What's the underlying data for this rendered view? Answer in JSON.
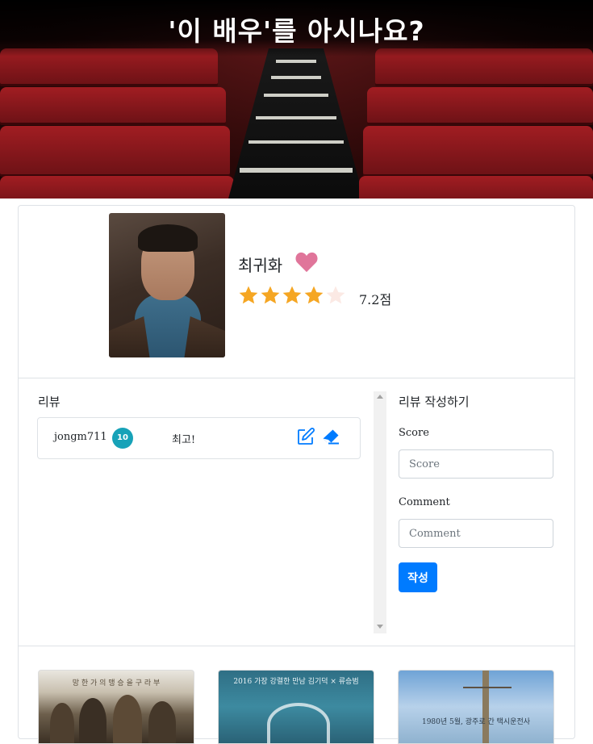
{
  "banner": {
    "title": "'이 배우'를 아시나요?"
  },
  "actor": {
    "name": "최귀화",
    "rating": 7.2,
    "rating_label": "7.2점",
    "stars_filled": 4,
    "stars_total": 5,
    "liked": true
  },
  "reviews": {
    "title": "리뷰",
    "items": [
      {
        "user": "jongm711",
        "score": "10",
        "comment": "최고!"
      }
    ]
  },
  "review_form": {
    "title": "리뷰 작성하기",
    "score_label": "Score",
    "score_placeholder": "Score",
    "comment_label": "Comment",
    "comment_placeholder": "Comment",
    "submit_label": "작성"
  },
  "posters": [
    {
      "caption": "망 한 가 의 맹 승 을 구 라 부"
    },
    {
      "caption": "2016 가장 강렬한 만남 김기덕 × 류승범"
    },
    {
      "caption": "1980년 5월, 광주로 간 택시운전사"
    }
  ],
  "colors": {
    "accent": "#007bff",
    "badge": "#17a2b8",
    "heart": "#e0759a",
    "star": "#f5a623"
  }
}
